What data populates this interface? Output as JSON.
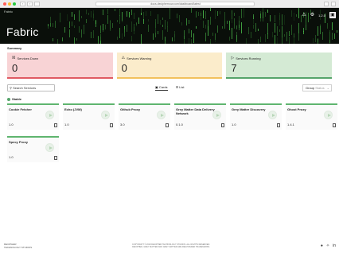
{
  "browser": {
    "url": " docs.deciphernow.com/dashboard/latest",
    "nav_back": "‹",
    "nav_forward": "›",
    "colors": {
      "close": "#ff5f57",
      "min": "#febc2e",
      "max": "#28c840"
    }
  },
  "header": {
    "crumb": "Fabric",
    "title": "Fabric",
    "alert_icon": "⚠",
    "settings_icon": "⚙",
    "version": "1.2.0",
    "exit_icon": "▣"
  },
  "summary": {
    "label": "Summary",
    "cards": [
      {
        "icon": "☒",
        "title": "Services Down",
        "count": "0"
      },
      {
        "icon": "⚠",
        "title": "Services Warning",
        "count": "0"
      },
      {
        "icon": "▷",
        "title": "Services Running",
        "count": "7"
      }
    ]
  },
  "toolbar": {
    "search_icon": "⚲",
    "search_placeholder": "Search Services",
    "cards_label": "Cards",
    "list_label": "List",
    "group_label": "Group",
    "group_value": "Status",
    "group_chevron": "⌄"
  },
  "section": {
    "label": "Stable"
  },
  "services": [
    {
      "name": "Cookie Fetcher",
      "version": "1.0"
    },
    {
      "name": "Echo (JVM)",
      "version": "1.0"
    },
    {
      "name": "Github Proxy",
      "version": "3.0"
    },
    {
      "name": "Grey Matter Data Delivery Network",
      "version": "0.1.0"
    },
    {
      "name": "Grey Matter Discovery",
      "version": "1.0"
    },
    {
      "name": "Ghost Proxy",
      "version": "1.4.1"
    },
    {
      "name": "Specy Proxy",
      "version": "1.0"
    }
  ],
  "footer": {
    "logo_line1": "DECIPHER",
    "logo_line2": "TECHNOLOGY STUDIOS",
    "copy_line1": "COPYRIGHT © 2018 DECIPHER TECHNOLOGY STUDIOS. ALL RIGHTS RESERVED.",
    "copy_line2": "DECIPHER, GREY MATTER AND GREY MATTER ARE REGISTERED TRADEMARKS.",
    "github_icon": "●",
    "twitter_icon": "✧",
    "linkedin_icon": "in"
  }
}
